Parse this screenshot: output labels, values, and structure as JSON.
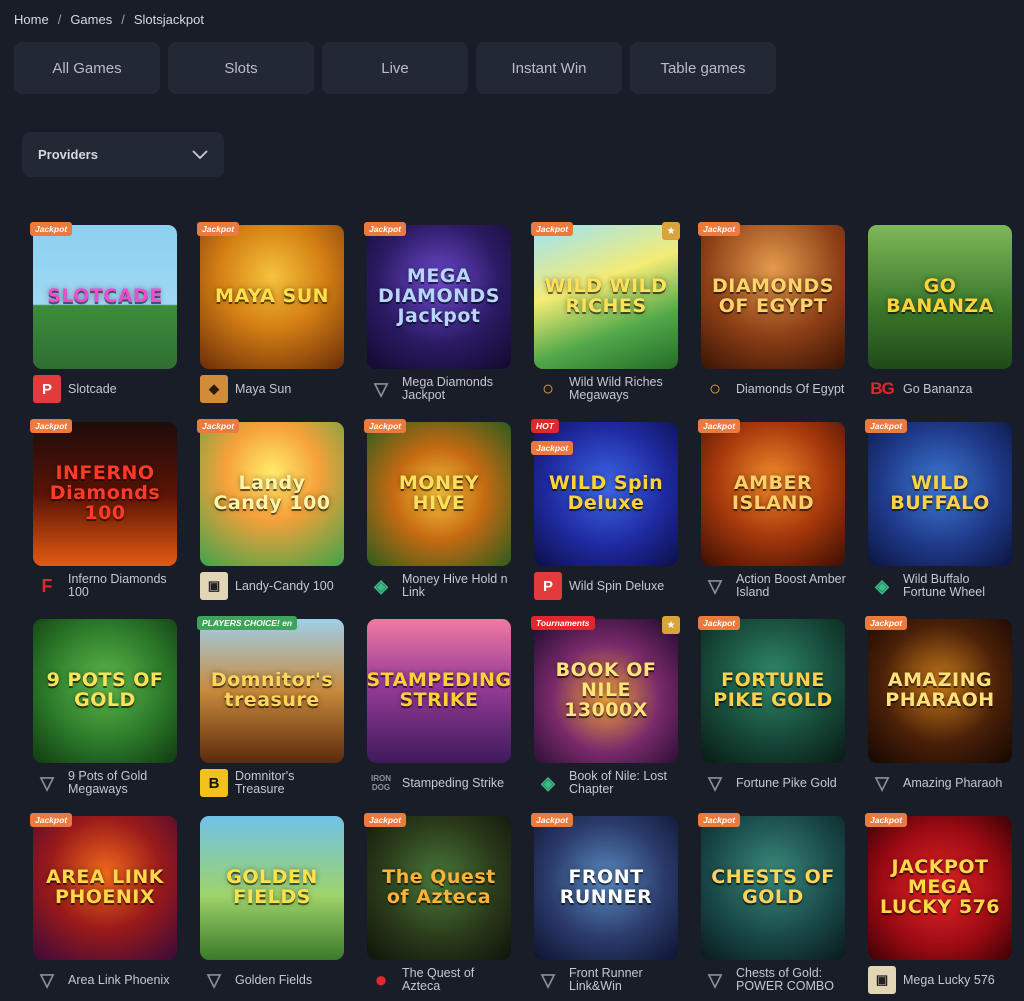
{
  "breadcrumb": [
    "Home",
    "Games",
    "Slotsjackpot"
  ],
  "tabs": [
    "All Games",
    "Slots",
    "Live",
    "Instant Win",
    "Table games"
  ],
  "providers_label": "Providers",
  "games": [
    {
      "name": "Slotcade",
      "badge": "Jackpot",
      "prov_icon": "P",
      "prov_class": "p",
      "logo": "SLOTCADE",
      "bg": "linear-gradient(180deg,#8bd0f0 0%,#9fd8f2 55%,#3c8d3c 56%,#2f6e32 100%)",
      "color": "#f14bd2"
    },
    {
      "name": "Maya Sun",
      "badge": "Jackpot",
      "prov_icon": "◆",
      "prov_class": "bear",
      "logo": "MAYA SUN",
      "bg": "radial-gradient(circle at 50% 35%,#f5c23c 0%,#d47f14 45%,#6a2d08 100%)",
      "color": "#ffe04b"
    },
    {
      "name": "Mega Diamonds Jackpot",
      "badge": "Jackpot",
      "prov_icon": "▽",
      "prov_class": "tri",
      "logo": "MEGA DIAMONDS Jackpot",
      "bg": "radial-gradient(circle at 50% 40%,#6f4ad1 0%,#2b1a63 55%,#120a2e 100%)",
      "color": "#b6d5ff"
    },
    {
      "name": "Wild Wild Riches Megaways",
      "badge": "Jackpot",
      "trophy": true,
      "prov_icon": "○",
      "prov_class": "pp",
      "logo": "WILD WILD RICHES",
      "bg": "linear-gradient(160deg,#9be3f9 0%,#f4ec74 40%,#52a94a 70%,#236c27 100%)",
      "color": "#ffe259"
    },
    {
      "name": "Diamonds Of Egypt",
      "badge": "Jackpot",
      "prov_icon": "○",
      "prov_class": "pp",
      "logo": "DIAMONDS OF EGYPT",
      "bg": "radial-gradient(circle at 50% 30%,#e39b4d 0%,#8d3f16 55%,#3a1405 100%)",
      "color": "#ffd36a"
    },
    {
      "name": "Go Bananza",
      "badge": "",
      "prov_icon": "BG",
      "prov_class": "bg",
      "logo": "GO BANANZA",
      "bg": "linear-gradient(180deg,#7fb85a 0%,#3d7a2c 55%,#1f4a18 100%)",
      "color": "#ffd43b"
    },
    {
      "name": "Inferno Diamonds 100",
      "badge": "Jackpot",
      "prov_icon": "F",
      "prov_class": "fire",
      "logo": "INFERNO Diamonds 100",
      "bg": "linear-gradient(180deg,#1e0c0a 0%,#5a1306 50%,#e35a12 100%)",
      "color": "#ff3b28"
    },
    {
      "name": "Landy-Candy 100",
      "badge": "Jackpot",
      "prov_icon": "▣",
      "prov_class": "box",
      "logo": "Landy Candy 100",
      "bg": "radial-gradient(circle at 50% 35%,#ffec6a 0%,#f6a13a 40%,#3ea34b 100%)",
      "color": "#fff3a8"
    },
    {
      "name": "Money Hive Hold n Link",
      "badge": "Jackpot",
      "prov_icon": "◈",
      "prov_class": "dia",
      "logo": "MONEY HIVE",
      "bg": "radial-gradient(circle at 50% 50%,#f6c13a 0%,#c56a12 45%,#2b5c1f 100%)",
      "color": "#ffde5a"
    },
    {
      "name": "Wild Spin Deluxe",
      "badge": "HOT",
      "badge2": "Jackpot",
      "prov_icon": "P",
      "prov_class": "p",
      "logo": "WILD Spin Deluxe",
      "bg": "radial-gradient(circle at 50% 45%,#3d67e8 0%,#1f2aa0 55%,#0c0f48 100%)",
      "color": "#ffd23a"
    },
    {
      "name": "Action Boost Amber Island",
      "badge": "Jackpot",
      "prov_icon": "▽",
      "prov_class": "tri",
      "logo": "AMBER ISLAND",
      "bg": "radial-gradient(circle at 50% 40%,#f08a2a 0%,#a8390c 50%,#3c0e03 100%)",
      "color": "#ffd06a"
    },
    {
      "name": "Wild Buffalo Fortune Wheel",
      "badge": "Jackpot",
      "prov_icon": "◈",
      "prov_class": "dia",
      "logo": "WILD BUFFALO",
      "bg": "radial-gradient(circle at 50% 45%,#3f7ad6 0%,#1f3a8a 55%,#0b1540 100%)",
      "color": "#ffd04a"
    },
    {
      "name": "9 Pots of Gold Megaways",
      "badge": "",
      "prov_icon": "▽",
      "prov_class": "tri",
      "logo": "9 POTS OF GOLD",
      "bg": "radial-gradient(circle at 50% 45%,#5fb84a 0%,#2c7a2a 55%,#113a12 100%)",
      "color": "#ffe15a"
    },
    {
      "name": "Domnitor's Treasure",
      "badge": "PLAYERS CHOICE! en",
      "badge_class": "green",
      "prov_icon": "B",
      "prov_class": "b",
      "logo": "Domnitor's treasure",
      "bg": "linear-gradient(180deg,#9ed0e8 0%,#c98a3c 50%,#5a2a0c 100%)",
      "color": "#ffd65a"
    },
    {
      "name": "Stampeding Strike",
      "badge": "",
      "prov_icon": "IRON DOG",
      "prov_class": "dog",
      "logo": "STAMPEDING STRIKE",
      "bg": "linear-gradient(180deg,#f07aa0 0%,#9a3c9a 45%,#3c1a5a 100%)",
      "color": "#ffcf3a"
    },
    {
      "name": "Book of Nile: Lost Chapter",
      "badge": "Tournaments",
      "badge_class": "red",
      "trophy": true,
      "prov_icon": "◈",
      "prov_class": "dia",
      "logo": "BOOK OF NILE 13000X",
      "bg": "radial-gradient(circle at 50% 55%,#f0a23a 0%,#7a2a6a 50%,#1a0a2a 100%)",
      "color": "#ffe27a"
    },
    {
      "name": "Fortune Pike Gold",
      "badge": "Jackpot",
      "prov_icon": "▽",
      "prov_class": "tri",
      "logo": "FORTUNE PIKE GOLD",
      "bg": "radial-gradient(circle at 50% 40%,#2f8a6a 0%,#174a3a 55%,#081a14 100%)",
      "color": "#ffd04a"
    },
    {
      "name": "Amazing Pharaoh",
      "badge": "Jackpot",
      "prov_icon": "▽",
      "prov_class": "tri",
      "logo": "AMAZING PHARAOH",
      "bg": "radial-gradient(circle at 50% 45%,#c77a1a 0%,#4a2008 55%,#140702 100%)",
      "color": "#ffe07a"
    },
    {
      "name": "Area Link Phoenix",
      "badge": "Jackpot",
      "prov_icon": "▽",
      "prov_class": "tri",
      "logo": "AREA LINK PHOENIX",
      "bg": "radial-gradient(circle at 50% 40%,#f06a1a 0%,#9a1a1a 50%,#3a0a3a 100%)",
      "color": "#ffd84a"
    },
    {
      "name": "Golden Fields",
      "badge": "",
      "prov_icon": "▽",
      "prov_class": "tri",
      "logo": "GOLDEN FIELDS",
      "bg": "linear-gradient(180deg,#6fc2e8 0%,#9fd36a 55%,#3a7a2a 100%)",
      "color": "#ffe24a"
    },
    {
      "name": "The Quest of Azteca",
      "badge": "Jackpot",
      "prov_icon": "●",
      "prov_class": "circ",
      "logo": "The Quest of Azteca",
      "bg": "radial-gradient(circle at 50% 45%,#4a7a3a 0%,#2a3a1a 55%,#0e140a 100%)",
      "color": "#ffb23a"
    },
    {
      "name": "Front Runner Link&Win",
      "badge": "Jackpot",
      "prov_icon": "▽",
      "prov_class": "tri",
      "logo": "FRONT RUNNER",
      "bg": "radial-gradient(circle at 50% 45%,#5a8ac0 0%,#2a3a6a 55%,#0e1430 100%)",
      "color": "#ffffff"
    },
    {
      "name": "Chests of Gold: POWER COMBO",
      "badge": "Jackpot",
      "prov_icon": "▽",
      "prov_class": "tri",
      "logo": "CHESTS OF GOLD",
      "bg": "radial-gradient(circle at 50% 40%,#3a8a7a 0%,#1a4a4a 55%,#0a1a1a 100%)",
      "color": "#ffd45a"
    },
    {
      "name": "Mega Lucky 576",
      "badge": "Jackpot",
      "prov_icon": "▣",
      "prov_class": "box",
      "logo": "JACKPOT MEGA LUCKY 576",
      "bg": "radial-gradient(circle at 50% 50%,#e8262a 0%,#9a0a12 60%,#3a0206 100%)",
      "color": "#ffd84a"
    }
  ]
}
